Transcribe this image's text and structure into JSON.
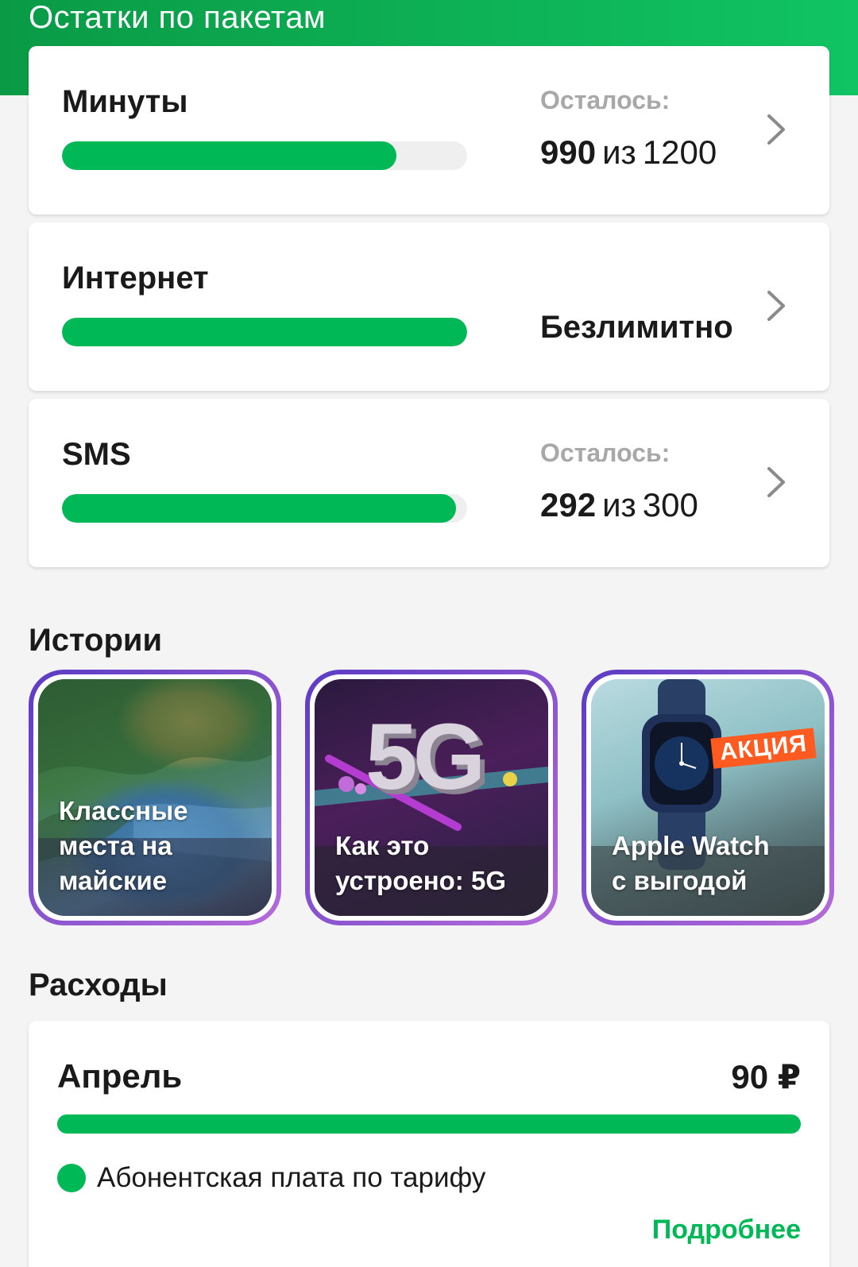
{
  "header": {
    "title": "Остатки по пакетам"
  },
  "packages": [
    {
      "name": "Минуты",
      "remain_label": "Осталось:",
      "remain": "990",
      "of": "из",
      "total": "1200",
      "fraction": 0.825,
      "unlimited": ""
    },
    {
      "name": "Интернет",
      "remain_label": "",
      "remain": "",
      "of": "",
      "total": "",
      "fraction": 1.0,
      "unlimited": "Безлимитно"
    },
    {
      "name": "SMS",
      "remain_label": "Осталось:",
      "remain": "292",
      "of": "из",
      "total": "300",
      "fraction": 0.973,
      "unlimited": ""
    }
  ],
  "stories": {
    "title": "Истории",
    "items": [
      {
        "text": "Классные\nместа на\nмайские",
        "icon": "lake-landscape-image"
      },
      {
        "text": "Как это\nустроено: 5G",
        "icon": "5g-render-image",
        "overlay": "5G"
      },
      {
        "text": "Apple Watch\nс выгодой",
        "icon": "apple-watch-image",
        "badge": "АКЦИЯ"
      }
    ]
  },
  "expenses": {
    "title": "Расходы",
    "month": "Апрель",
    "amount": "90 ₽",
    "legend": "Абонентская плата по тарифу",
    "more": "Подробнее",
    "fraction": 1.0
  },
  "colors": {
    "accent": "#00b956",
    "header_start": "#0a9a46",
    "header_end": "#10c463",
    "story_ring": "#8a55d0"
  }
}
